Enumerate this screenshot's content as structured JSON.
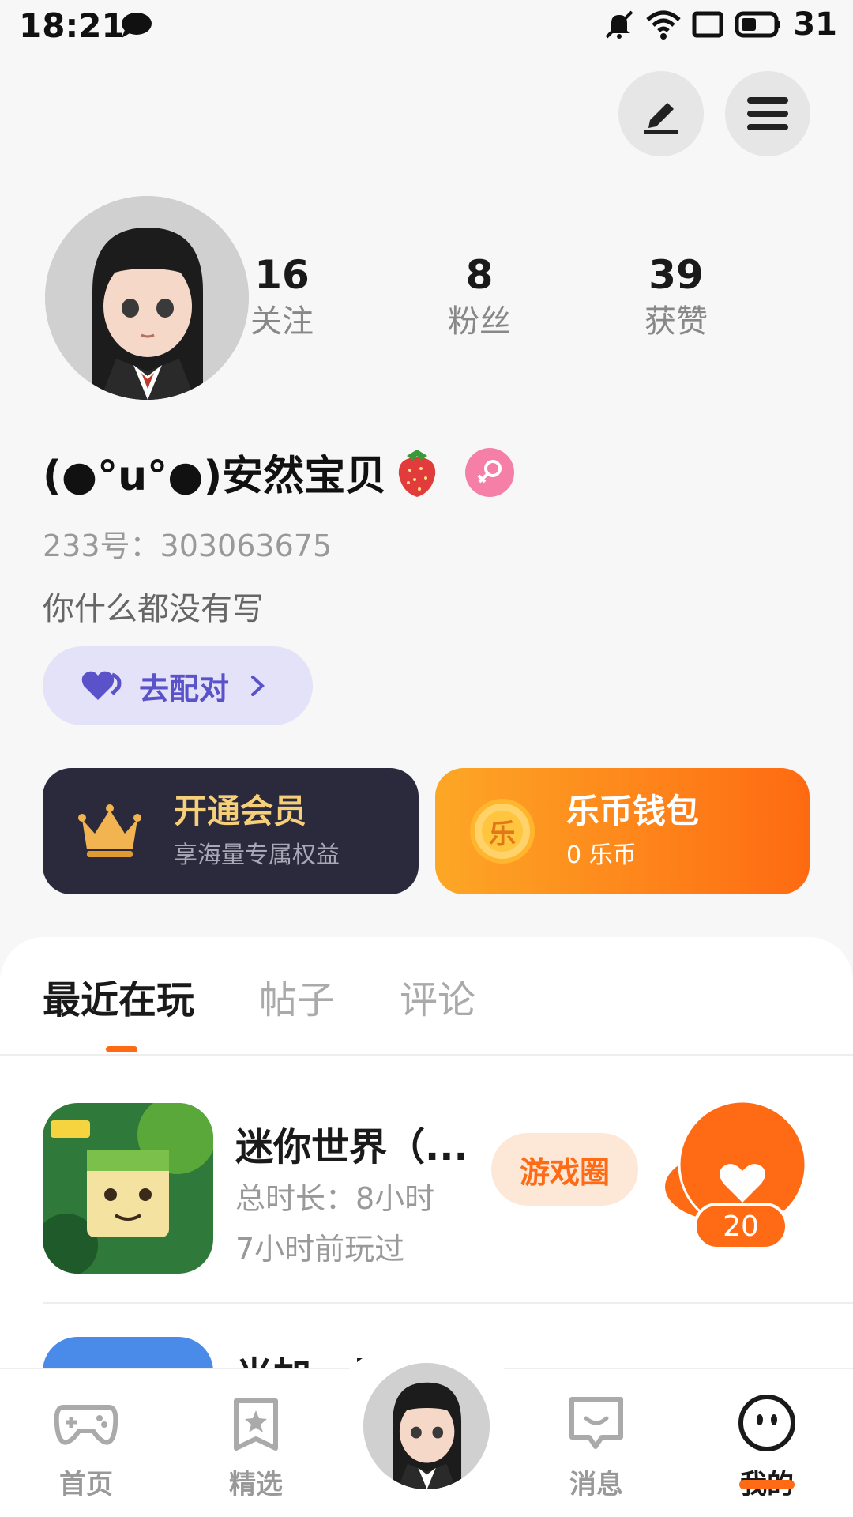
{
  "status_bar": {
    "time": "18:21",
    "battery": "31",
    "icons": [
      "chat-bubble-icon",
      "mute-icon",
      "wifi-icon",
      "screen-icon",
      "battery-icon"
    ]
  },
  "header_actions": {
    "edit_icon": "pencil-icon",
    "menu_icon": "menu-icon"
  },
  "profile": {
    "stats": [
      {
        "value": "16",
        "label": "关注"
      },
      {
        "value": "8",
        "label": "粉丝"
      },
      {
        "value": "39",
        "label": "获赞"
      }
    ],
    "username": "(●°u°●)安然宝贝",
    "uid": "233号：303063675",
    "bio": "你什么都没有写",
    "match_label": "去配对"
  },
  "cards": {
    "vip": {
      "title": "开通会员",
      "subtitle": "享海量专属权益"
    },
    "wallet": {
      "title": "乐币钱包",
      "subtitle": "0 乐币",
      "coin_glyph": "乐"
    }
  },
  "tabs": [
    {
      "label": "最近在玩",
      "active": true
    },
    {
      "label": "帖子",
      "active": false
    },
    {
      "label": "评论",
      "active": false
    }
  ],
  "games": [
    {
      "name": "迷你世界（...",
      "total_time": "总时长：8小时",
      "last_played": "7小时前玩过",
      "circle_label": "游戏圈",
      "likes": "20"
    },
    {
      "name": "光加...图"
    }
  ],
  "bottom_nav": [
    {
      "label": "首页",
      "icon": "gamepad-icon",
      "active": false
    },
    {
      "label": "精选",
      "icon": "star-icon",
      "active": false
    },
    {
      "label": "消息",
      "icon": "message-icon",
      "active": false
    },
    {
      "label": "我的",
      "icon": "face-icon",
      "active": true
    }
  ],
  "colors": {
    "accent": "#ff6a15",
    "match_purple": "#5a52c9",
    "vip_dark": "#2b2a3d",
    "vip_gold": "#f6cf7a",
    "gender_pink": "#f57fa6"
  }
}
